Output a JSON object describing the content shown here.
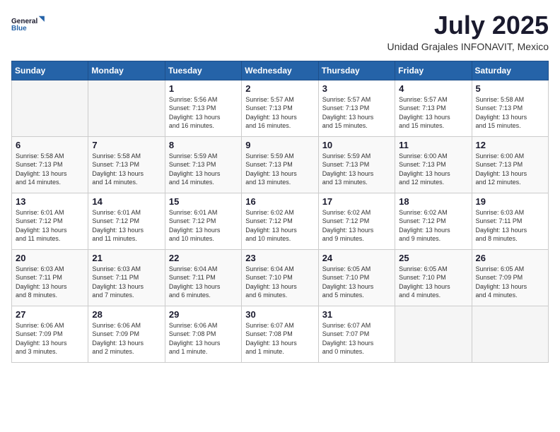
{
  "header": {
    "logo_line1": "General",
    "logo_line2": "Blue",
    "month": "July 2025",
    "location": "Unidad Grajales INFONAVIT, Mexico"
  },
  "days_of_week": [
    "Sunday",
    "Monday",
    "Tuesday",
    "Wednesday",
    "Thursday",
    "Friday",
    "Saturday"
  ],
  "weeks": [
    [
      {
        "day": "",
        "info": ""
      },
      {
        "day": "",
        "info": ""
      },
      {
        "day": "1",
        "info": "Sunrise: 5:56 AM\nSunset: 7:13 PM\nDaylight: 13 hours\nand 16 minutes."
      },
      {
        "day": "2",
        "info": "Sunrise: 5:57 AM\nSunset: 7:13 PM\nDaylight: 13 hours\nand 16 minutes."
      },
      {
        "day": "3",
        "info": "Sunrise: 5:57 AM\nSunset: 7:13 PM\nDaylight: 13 hours\nand 15 minutes."
      },
      {
        "day": "4",
        "info": "Sunrise: 5:57 AM\nSunset: 7:13 PM\nDaylight: 13 hours\nand 15 minutes."
      },
      {
        "day": "5",
        "info": "Sunrise: 5:58 AM\nSunset: 7:13 PM\nDaylight: 13 hours\nand 15 minutes."
      }
    ],
    [
      {
        "day": "6",
        "info": "Sunrise: 5:58 AM\nSunset: 7:13 PM\nDaylight: 13 hours\nand 14 minutes."
      },
      {
        "day": "7",
        "info": "Sunrise: 5:58 AM\nSunset: 7:13 PM\nDaylight: 13 hours\nand 14 minutes."
      },
      {
        "day": "8",
        "info": "Sunrise: 5:59 AM\nSunset: 7:13 PM\nDaylight: 13 hours\nand 14 minutes."
      },
      {
        "day": "9",
        "info": "Sunrise: 5:59 AM\nSunset: 7:13 PM\nDaylight: 13 hours\nand 13 minutes."
      },
      {
        "day": "10",
        "info": "Sunrise: 5:59 AM\nSunset: 7:13 PM\nDaylight: 13 hours\nand 13 minutes."
      },
      {
        "day": "11",
        "info": "Sunrise: 6:00 AM\nSunset: 7:13 PM\nDaylight: 13 hours\nand 12 minutes."
      },
      {
        "day": "12",
        "info": "Sunrise: 6:00 AM\nSunset: 7:13 PM\nDaylight: 13 hours\nand 12 minutes."
      }
    ],
    [
      {
        "day": "13",
        "info": "Sunrise: 6:01 AM\nSunset: 7:12 PM\nDaylight: 13 hours\nand 11 minutes."
      },
      {
        "day": "14",
        "info": "Sunrise: 6:01 AM\nSunset: 7:12 PM\nDaylight: 13 hours\nand 11 minutes."
      },
      {
        "day": "15",
        "info": "Sunrise: 6:01 AM\nSunset: 7:12 PM\nDaylight: 13 hours\nand 10 minutes."
      },
      {
        "day": "16",
        "info": "Sunrise: 6:02 AM\nSunset: 7:12 PM\nDaylight: 13 hours\nand 10 minutes."
      },
      {
        "day": "17",
        "info": "Sunrise: 6:02 AM\nSunset: 7:12 PM\nDaylight: 13 hours\nand 9 minutes."
      },
      {
        "day": "18",
        "info": "Sunrise: 6:02 AM\nSunset: 7:12 PM\nDaylight: 13 hours\nand 9 minutes."
      },
      {
        "day": "19",
        "info": "Sunrise: 6:03 AM\nSunset: 7:11 PM\nDaylight: 13 hours\nand 8 minutes."
      }
    ],
    [
      {
        "day": "20",
        "info": "Sunrise: 6:03 AM\nSunset: 7:11 PM\nDaylight: 13 hours\nand 8 minutes."
      },
      {
        "day": "21",
        "info": "Sunrise: 6:03 AM\nSunset: 7:11 PM\nDaylight: 13 hours\nand 7 minutes."
      },
      {
        "day": "22",
        "info": "Sunrise: 6:04 AM\nSunset: 7:11 PM\nDaylight: 13 hours\nand 6 minutes."
      },
      {
        "day": "23",
        "info": "Sunrise: 6:04 AM\nSunset: 7:10 PM\nDaylight: 13 hours\nand 6 minutes."
      },
      {
        "day": "24",
        "info": "Sunrise: 6:05 AM\nSunset: 7:10 PM\nDaylight: 13 hours\nand 5 minutes."
      },
      {
        "day": "25",
        "info": "Sunrise: 6:05 AM\nSunset: 7:10 PM\nDaylight: 13 hours\nand 4 minutes."
      },
      {
        "day": "26",
        "info": "Sunrise: 6:05 AM\nSunset: 7:09 PM\nDaylight: 13 hours\nand 4 minutes."
      }
    ],
    [
      {
        "day": "27",
        "info": "Sunrise: 6:06 AM\nSunset: 7:09 PM\nDaylight: 13 hours\nand 3 minutes."
      },
      {
        "day": "28",
        "info": "Sunrise: 6:06 AM\nSunset: 7:09 PM\nDaylight: 13 hours\nand 2 minutes."
      },
      {
        "day": "29",
        "info": "Sunrise: 6:06 AM\nSunset: 7:08 PM\nDaylight: 13 hours\nand 1 minute."
      },
      {
        "day": "30",
        "info": "Sunrise: 6:07 AM\nSunset: 7:08 PM\nDaylight: 13 hours\nand 1 minute."
      },
      {
        "day": "31",
        "info": "Sunrise: 6:07 AM\nSunset: 7:07 PM\nDaylight: 13 hours\nand 0 minutes."
      },
      {
        "day": "",
        "info": ""
      },
      {
        "day": "",
        "info": ""
      }
    ]
  ]
}
